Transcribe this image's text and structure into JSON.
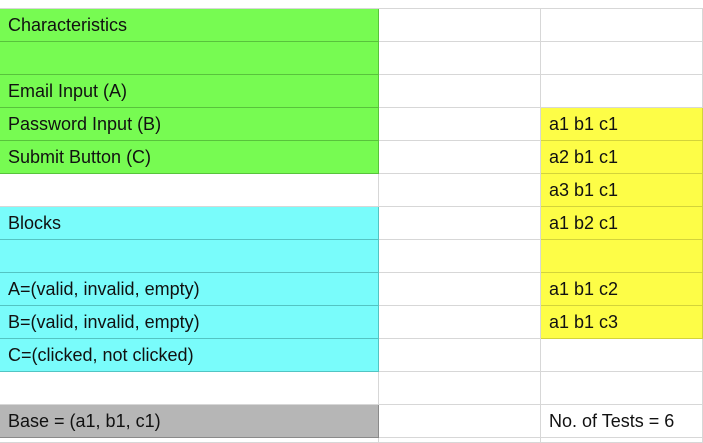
{
  "sheet": {
    "col_a": {
      "characteristics": "Characteristics",
      "email_input": "Email Input (A)",
      "password_input": "Password Input (B)",
      "submit_button": "Submit Button (C)",
      "blocks": "Blocks",
      "block_a": "A=(valid, invalid, empty)",
      "block_b": "B=(valid, invalid, empty)",
      "block_c": "C=(clicked, not clicked)",
      "base": "Base = (a1, b1, c1)"
    },
    "col_c": {
      "test_1": "a1 b1 c1",
      "test_2": "a2 b1 c1",
      "test_3": "a3 b1 c1",
      "test_4": "a1 b2 c1",
      "test_5": "a1 b1 c2",
      "test_6": "a1 b1 c3",
      "num_tests": "No. of Tests = 6"
    }
  },
  "colors": {
    "characteristics_fill": "#77fb52",
    "blocks_fill": "#79fcfb",
    "base_fill": "#b6b6b6",
    "tests_fill": "#fdfd47"
  }
}
